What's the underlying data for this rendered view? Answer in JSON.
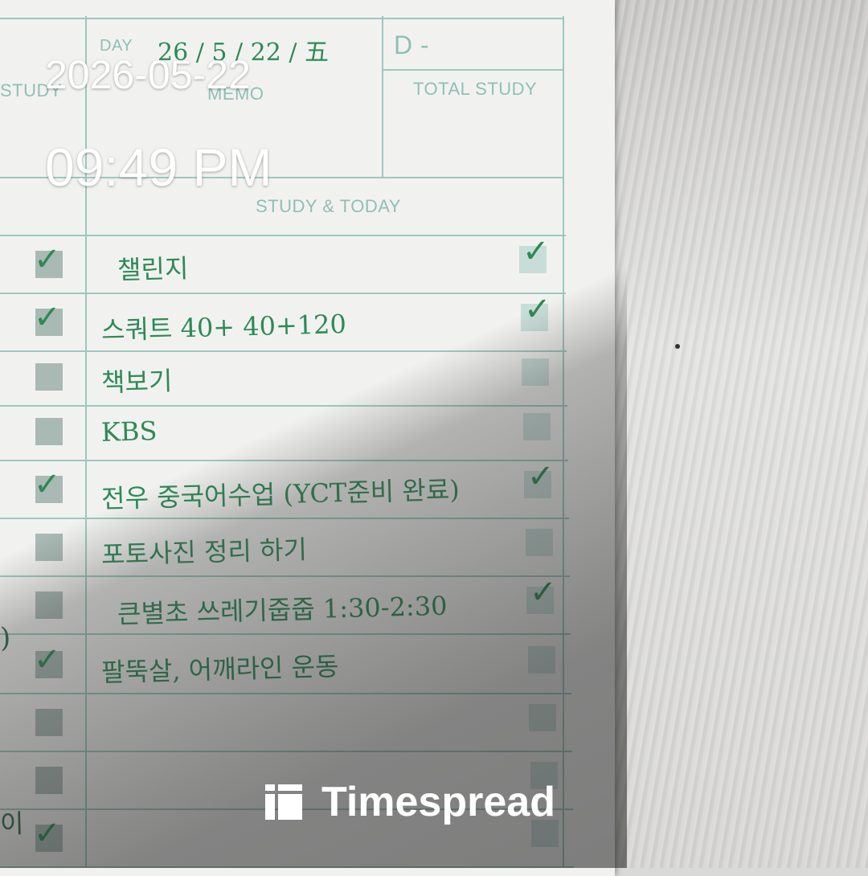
{
  "overlay": {
    "date": "2026-05-22",
    "time": "09:49 PM",
    "brand": "Timespread",
    "brand_icon": "timespread-logo-icon"
  },
  "planner": {
    "day_label": "DAY",
    "day_value": "26 / 5 / 22 / 五",
    "dday_label": "D -",
    "left_header_partial": "STUDY",
    "memo_label": "MEMO",
    "total_study_label": "TOTAL STUDY",
    "study_today_label": "STUDY & TODAY",
    "rows": [
      {
        "text": "챌린지",
        "left_checked": true,
        "right_checked": true
      },
      {
        "text": "스쿼트 40+ 40+120",
        "left_checked": true,
        "right_checked": true
      },
      {
        "text": "책보기",
        "left_checked": false,
        "right_checked": false
      },
      {
        "text": "KBS",
        "left_checked": false,
        "right_checked": false
      },
      {
        "text": "전우 중국어수업 (YCT준비 완료)",
        "left_checked": true,
        "right_checked": true
      },
      {
        "text": "포토사진 정리 하기",
        "left_checked": false,
        "right_checked": false
      },
      {
        "text": "큰별초 쓰레기줍줍 1:30-2:30",
        "left_checked": false,
        "right_checked": true
      },
      {
        "text": "팔뚝살, 어깨라인 운동",
        "left_checked": true,
        "right_checked": false
      },
      {
        "text": "",
        "left_checked": false,
        "right_checked": false
      },
      {
        "text": "",
        "left_checked": false,
        "right_checked": false
      },
      {
        "text": "",
        "left_checked": true,
        "right_checked": false
      }
    ],
    "check_mark": "✓",
    "edge_marks": [
      ")",
      "이"
    ]
  },
  "colors": {
    "ink": "#2e8a55",
    "grid": "#9cc7bf",
    "paper": "#f1f2f0"
  }
}
